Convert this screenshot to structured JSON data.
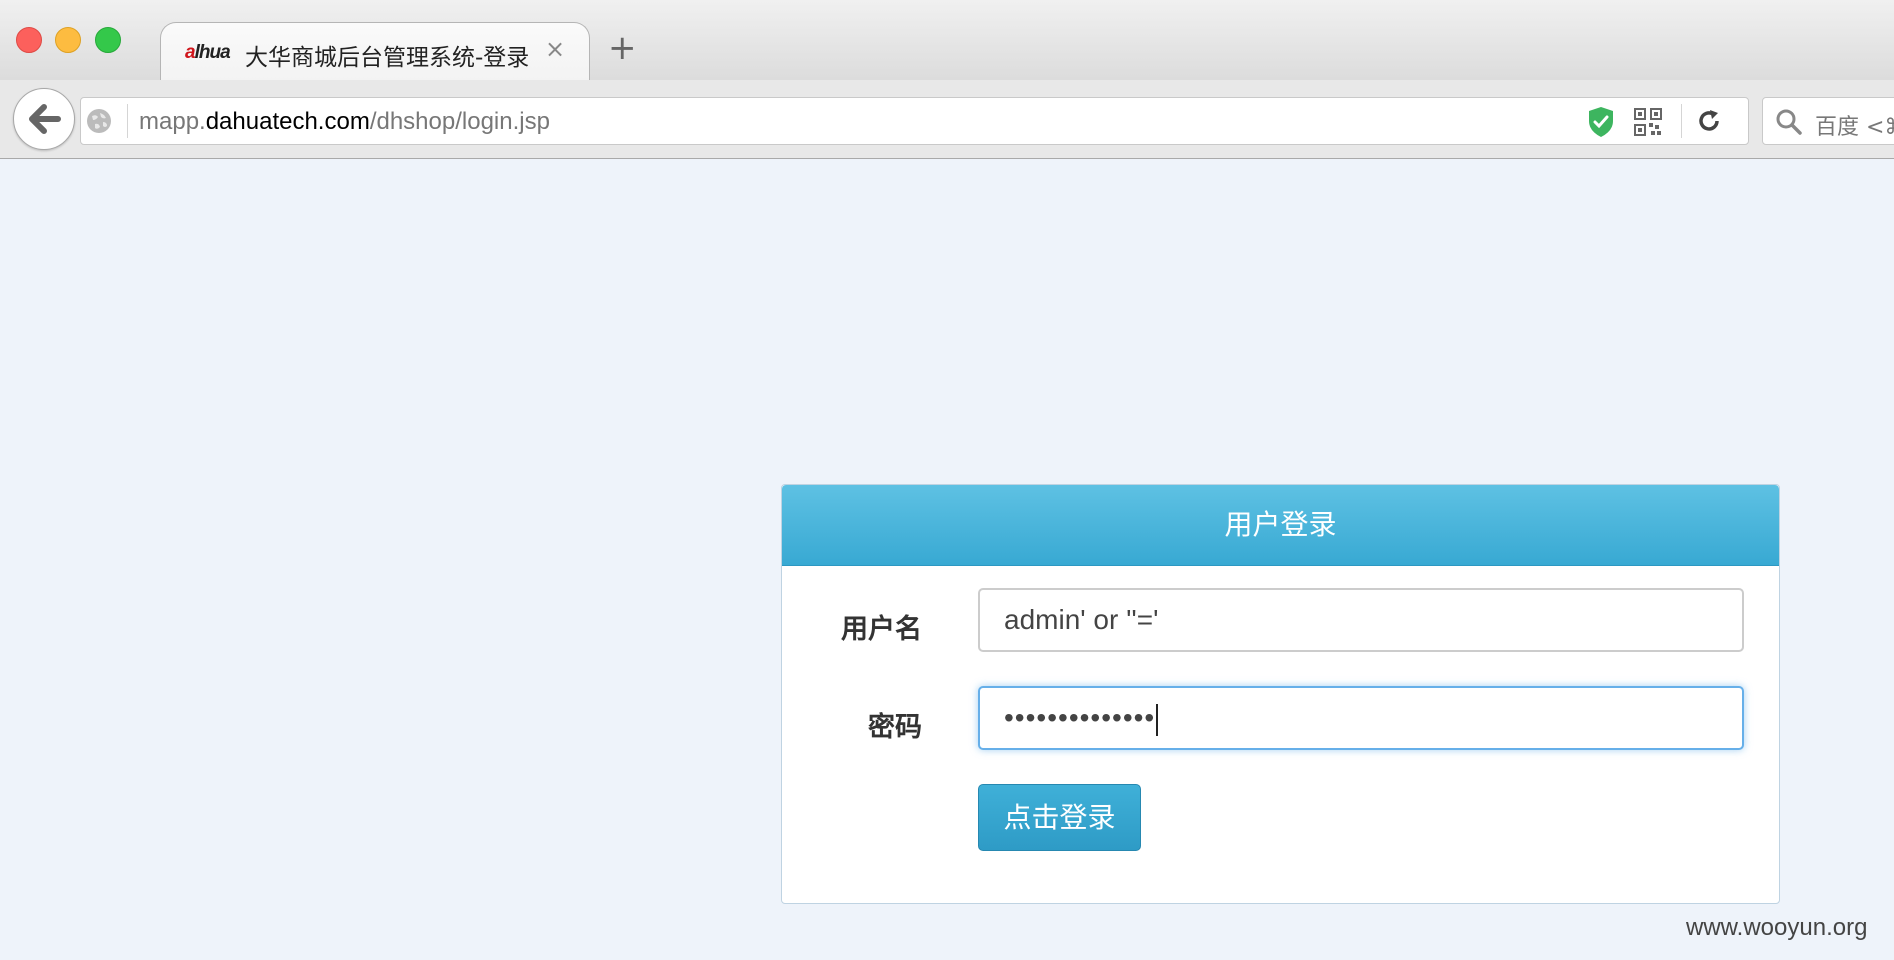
{
  "browser": {
    "tab": {
      "logo_text": "alhua",
      "title": "大华商城后台管理系统-登录",
      "close_glyph": "×"
    },
    "new_tab_glyph": "+",
    "url": {
      "prefix": "mapp.",
      "domain": "dahuatech.com",
      "path": "/dhshop/login.jsp"
    },
    "search": {
      "placeholder": "百度 <⌘"
    },
    "icons": [
      "back-arrow-icon",
      "globe-icon",
      "shield-check-icon",
      "qr-code-icon",
      "reload-icon",
      "search-icon",
      "close-icon",
      "plus-icon"
    ],
    "colors": {
      "traffic_close": "#fc605c",
      "traffic_min": "#fdbc40",
      "traffic_max": "#34c84a",
      "shield": "#3db55f"
    }
  },
  "login": {
    "heading": "用户登录",
    "username_label": "用户名",
    "username_value": "admin' or ''='",
    "password_label": "密码",
    "password_masked": "••••••••••••••",
    "submit_label": "点击登录",
    "colors": {
      "header": "#4cb6de",
      "button": "#34a3cf",
      "focus_border": "#66afe9",
      "page_bg": "#eef3fa"
    }
  },
  "watermark": "www.wooyun.org"
}
